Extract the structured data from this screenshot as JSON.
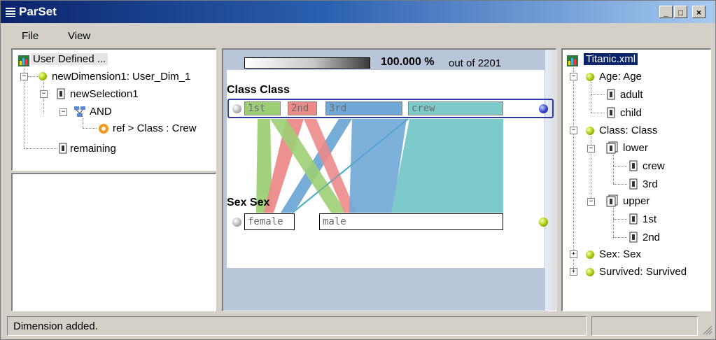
{
  "window": {
    "title": "ParSet"
  },
  "menu": {
    "items": [
      "File",
      "View"
    ]
  },
  "left_tree": {
    "root": "User Defined ...",
    "dimension": "newDimension1: User_Dim_1",
    "selection": "newSelection1",
    "and": "AND",
    "ref": "ref > Class : Crew",
    "remaining": "remaining"
  },
  "center": {
    "percent": "100.000 %",
    "out_of": "out of 2201",
    "class_label": "Class Class",
    "sex_label": "Sex Sex"
  },
  "chart_data": {
    "type": "parallel-sets",
    "total": 2201,
    "shown_percent": 100.0,
    "dimensions": [
      {
        "name": "Class Class",
        "categories": [
          "1st",
          "2nd",
          "3rd",
          "crew"
        ],
        "colors": [
          "#9ccf74",
          "#ec8a8a",
          "#6fa8d6",
          "#7ccaca"
        ]
      },
      {
        "name": "Sex Sex",
        "categories": [
          "female",
          "male"
        ]
      }
    ]
  },
  "right_tree": {
    "root": "Titanic.xml",
    "age": "Age: Age",
    "adult": "adult",
    "child": "child",
    "class": "Class: Class",
    "lower": "lower",
    "crew": "crew",
    "third": "3rd",
    "upper": "upper",
    "first": "1st",
    "second": "2nd",
    "sex": "Sex: Sex",
    "survived": "Survived: Survived"
  },
  "status": {
    "message": "Dimension added."
  }
}
